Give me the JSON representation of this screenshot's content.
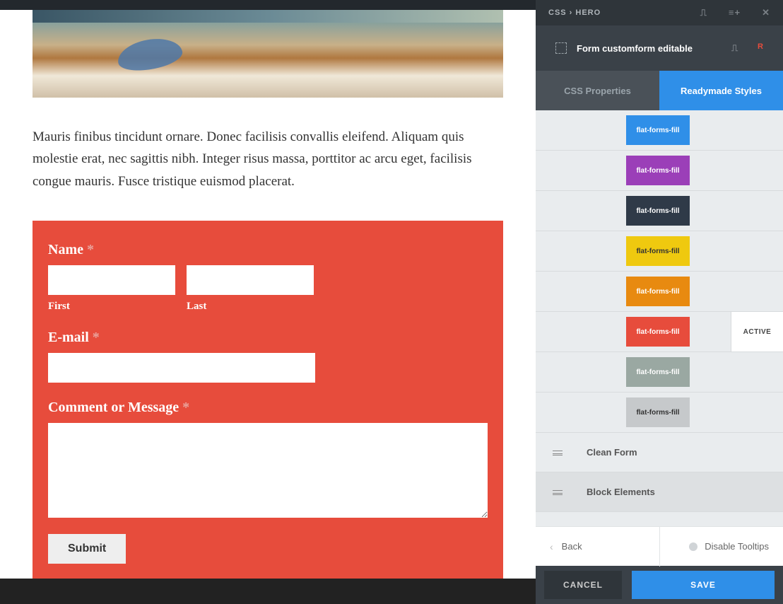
{
  "panel": {
    "brand": "CSS › HERO",
    "selection_label": "Form customform editable",
    "r_icon": "R",
    "tabs": {
      "css_properties": "CSS Properties",
      "readymade": "Readymade Styles"
    },
    "styles": [
      {
        "label": "flat-forms-fill",
        "bg": "#2f8fe8",
        "text": "light"
      },
      {
        "label": "flat-forms-fill",
        "bg": "#9b3fb8",
        "text": "light"
      },
      {
        "label": "flat-forms-fill",
        "bg": "#2f3a48",
        "text": "light"
      },
      {
        "label": "flat-forms-fill",
        "bg": "#efc90f",
        "text": "dark"
      },
      {
        "label": "flat-forms-fill",
        "bg": "#e88a10",
        "text": "light"
      },
      {
        "label": "flat-forms-fill",
        "bg": "#e74c3c",
        "text": "light",
        "active": true
      },
      {
        "label": "flat-forms-fill",
        "bg": "#9aa8a2",
        "text": "light"
      },
      {
        "label": "flat-forms-fill",
        "bg": "#c6c9cb",
        "text": "dark"
      }
    ],
    "active_label": "ACTIVE",
    "sections": {
      "clean_form": "Clean Form",
      "block_elements": "Block Elements"
    },
    "footer": {
      "back": "Back",
      "disable_tooltips": "Disable Tooltips",
      "cancel": "CANCEL",
      "save": "SAVE"
    }
  },
  "content": {
    "body_text": "Mauris finibus tincidunt ornare. Donec facilisis convallis eleifend. Aliquam quis molestie erat, nec sagittis nibh. Integer risus massa, porttitor ac arcu eget, facilisis congue mauris. Fusce tristique euismod placerat."
  },
  "form": {
    "name_label": "Name ",
    "first_label": "First",
    "last_label": "Last",
    "email_label": "E-mail ",
    "comment_label": "Comment or Message ",
    "required": "*",
    "submit": "Submit"
  }
}
